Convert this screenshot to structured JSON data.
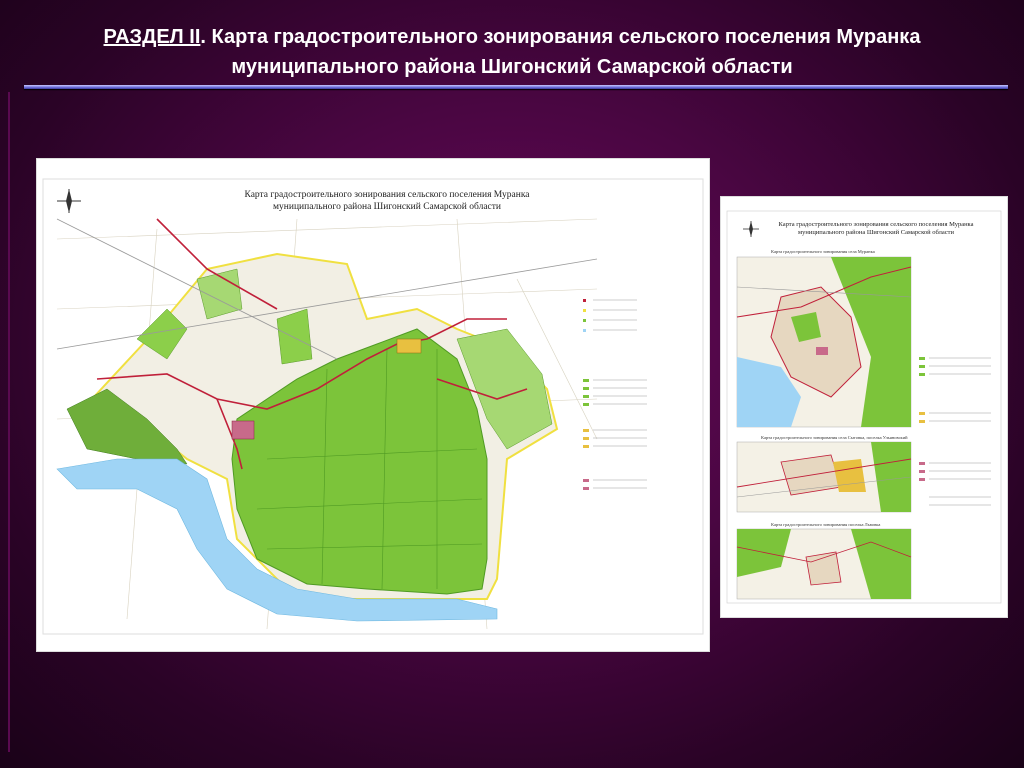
{
  "slide": {
    "section_label": "РАЗДЕЛ II",
    "title_rest": ". Карта градостроительного зонирования сельского поселения Муранка",
    "title_line2": "муниципального района Шигонский Самарской области"
  },
  "map_main": {
    "caption_line1": "Карта градостроительного зонирования сельского поселения Муранка",
    "caption_line2": "муниципального района Шигонский Самарской области"
  },
  "map_secondary": {
    "caption_line1": "Карта градостроительного зонирования сельского поселения Муранка",
    "caption_line2": "муниципального района Шигонский Самарской области",
    "inset1_title": "Карта градостроительного зонирования села Муранка",
    "inset2_title": "Карта градостроительного зонирования села Сытовка, поселка Ульяновский",
    "inset3_title": "Карта градостроительного зонирования поселка Львовка"
  },
  "colors": {
    "forest": "#7cc43a",
    "forest_dark": "#4f9a23",
    "water": "#9fd4f5",
    "boundary": "#f0e040",
    "road": "#c0203a",
    "field": "#f2efe4"
  }
}
